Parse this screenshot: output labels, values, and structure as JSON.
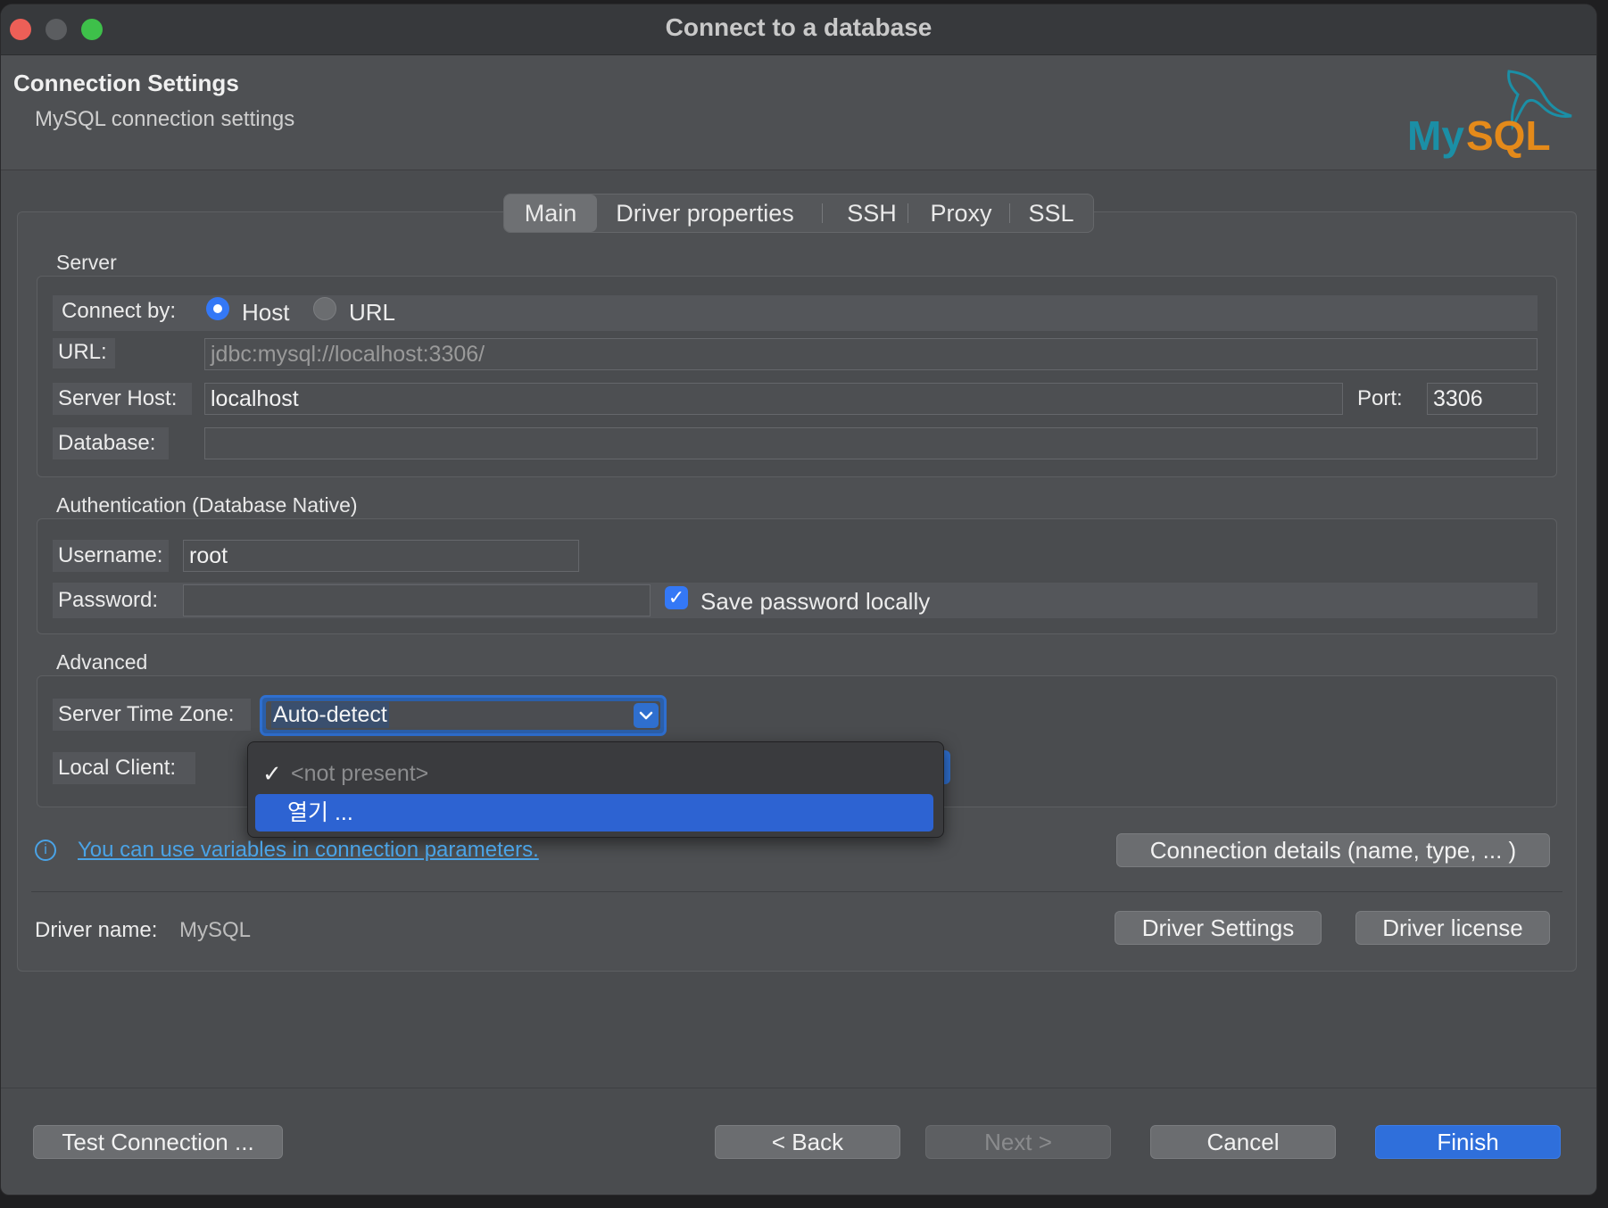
{
  "window": {
    "title": "Connect to a database"
  },
  "header": {
    "title": "Connection Settings",
    "subtitle": "MySQL connection settings",
    "logo_text": "MySQL"
  },
  "tabs": [
    {
      "label": "Main",
      "active": true
    },
    {
      "label": "Driver properties",
      "active": false
    },
    {
      "label": "SSH",
      "active": false
    },
    {
      "label": "Proxy",
      "active": false
    },
    {
      "label": "SSL",
      "active": false
    }
  ],
  "server": {
    "group_label": "Server",
    "connect_by_label": "Connect by:",
    "host_option": "Host",
    "url_option": "URL",
    "selected": "Host",
    "url_label": "URL:",
    "url_value": "jdbc:mysql://localhost:3306/",
    "host_label": "Server Host:",
    "host_value": "localhost",
    "port_label": "Port:",
    "port_value": "3306",
    "database_label": "Database:",
    "database_value": ""
  },
  "auth": {
    "group_label": "Authentication (Database Native)",
    "username_label": "Username:",
    "username_value": "root",
    "password_label": "Password:",
    "password_value": "",
    "save_password_label": "Save password locally",
    "save_password_checked": true
  },
  "advanced": {
    "group_label": "Advanced",
    "timezone_label": "Server Time Zone:",
    "timezone_value": "Auto-detect",
    "local_client_label": "Local Client:",
    "dropdown_items": [
      {
        "label": "<not present>",
        "checked": true
      },
      {
        "label": "열기 ...",
        "highlighted": true
      }
    ]
  },
  "info": {
    "link_text": "You can use variables in connection parameters."
  },
  "connection_details_button": "Connection details (name, type, ... )",
  "driver": {
    "name_label": "Driver name:",
    "name_value": "MySQL",
    "settings_button": "Driver Settings",
    "license_button": "Driver license"
  },
  "footer": {
    "test_button": "Test Connection ...",
    "back_button": "< Back",
    "next_button": "Next >",
    "cancel_button": "Cancel",
    "finish_button": "Finish"
  },
  "colors": {
    "accent": "#2f6fdb",
    "link": "#4aa3e6",
    "logo": "#1b8fa6"
  }
}
